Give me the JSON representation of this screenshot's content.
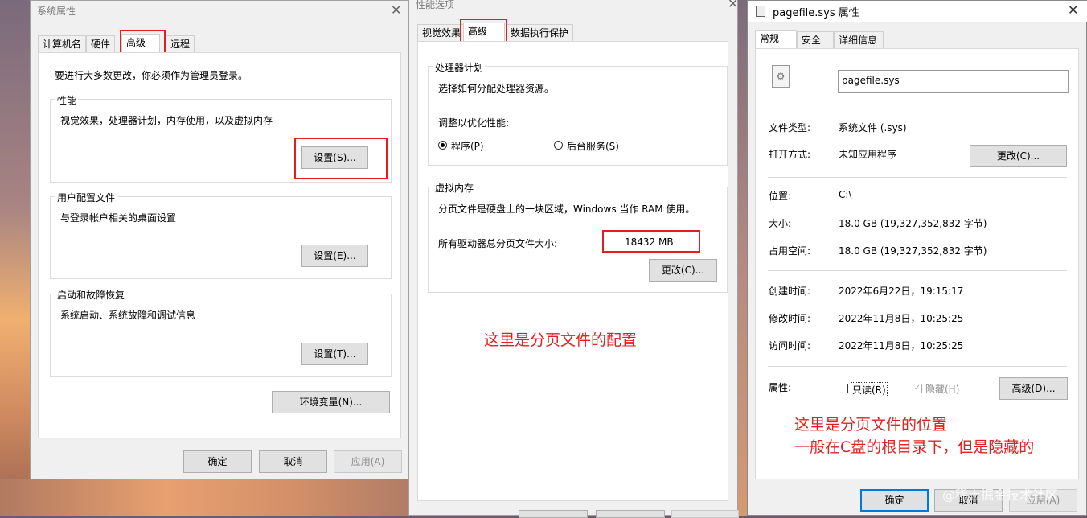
{
  "sys_props": {
    "title": "系统属性",
    "tabs": [
      "计算机名",
      "硬件",
      "高级",
      "远程"
    ],
    "admin_note": "要进行大多数更改，你必须作为管理员登录。",
    "performance": {
      "title": "性能",
      "desc": "视觉效果，处理器计划，内存使用，以及虚拟内存",
      "button": "设置(S)..."
    },
    "user_profile": {
      "title": "用户配置文件",
      "desc": "与登录帐户相关的桌面设置",
      "button": "设置(E)..."
    },
    "startup": {
      "title": "启动和故障恢复",
      "desc": "系统启动、系统故障和调试信息",
      "button": "设置(T)..."
    },
    "env_button": "环境变量(N)...",
    "ok": "确定",
    "cancel": "取消",
    "apply": "应用(A)"
  },
  "perf_opts": {
    "title": "性能选项",
    "tabs": [
      "视觉效果",
      "高级",
      "数据执行保护"
    ],
    "cpu": {
      "title": "处理器计划",
      "desc": "选择如何分配处理器资源。",
      "adjust": "调整以优化性能:",
      "opt1": "程序(P)",
      "opt2": "后台服务(S)"
    },
    "vm": {
      "title": "虚拟内存",
      "desc": "分页文件是硬盘上的一块区域，Windows 当作 RAM 使用。",
      "total_label": "所有驱动器总分页文件大小:",
      "total_value": "18432 MB",
      "change": "更改(C)..."
    },
    "annotation": "这里是分页文件的配置"
  },
  "file_props": {
    "title": "pagefile.sys 属性",
    "tabs": [
      "常规",
      "安全",
      "详细信息"
    ],
    "filename": "pagefile.sys",
    "type_label": "文件类型:",
    "type_value": "系统文件 (.sys)",
    "open_label": "打开方式:",
    "open_value": "未知应用程序",
    "change": "更改(C)...",
    "loc_label": "位置:",
    "loc_value": "C:\\",
    "size_label": "大小:",
    "size_value": "18.0 GB (19,327,352,832 字节)",
    "disk_label": "占用空间:",
    "disk_value": "18.0 GB (19,327,352,832 字节)",
    "created_label": "创建时间:",
    "created_value": "2022年6月22日，19:15:17",
    "modified_label": "修改时间:",
    "modified_value": "2022年11月8日，10:25:25",
    "accessed_label": "访问时间:",
    "accessed_value": "2022年11月8日，10:25:25",
    "attr_label": "属性:",
    "readonly": "只读(R)",
    "hidden": "隐藏(H)",
    "advanced": "高级(D)...",
    "annotation_line1": "这里是分页文件的位置",
    "annotation_line2": "一般在C盘的根目录下，但是隐藏的",
    "ok": "确定",
    "cancel": "取消",
    "apply": "应用(A)"
  },
  "watermark": "@稀土掘金技术社区",
  "colors": {
    "annotation": "#e02020",
    "accent": "#0078d7"
  }
}
